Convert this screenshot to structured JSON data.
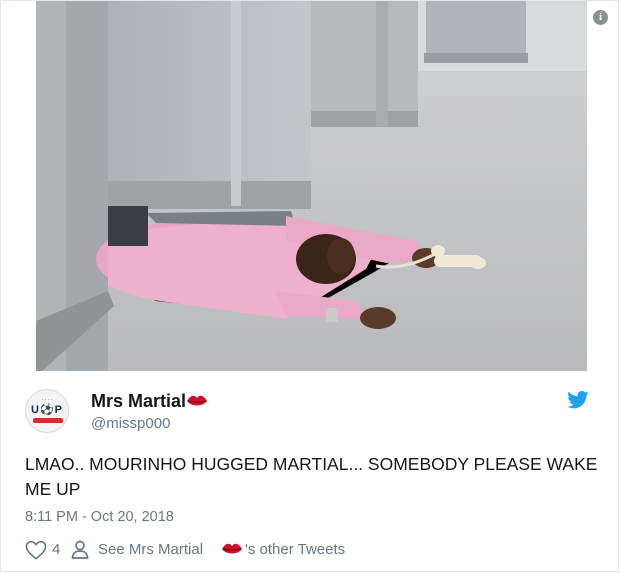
{
  "tweet": {
    "author_name": "Mrs Martial",
    "author_handle": "@missp000",
    "text": "LMAO.. MOURINHO HUGGED MARTIAL... SOMEBODY PLEASE WAKE ME UP",
    "timestamp": "8:11 PM - Oct 20, 2018",
    "like_count": "4",
    "see_other_prefix": "See Mrs Martial",
    "see_other_suffix": "'s other Tweets",
    "avatar_logo_text": "U⚽P"
  },
  "icons": {
    "info": "info-icon",
    "twitter": "twitter-bird-icon",
    "lips": "lips-emoji-icon",
    "like": "heart-icon",
    "profile": "person-icon"
  },
  "colors": {
    "twitter_blue": "#1da1f2",
    "secondary_text": "#657786",
    "lips_red": "#d1122f"
  }
}
